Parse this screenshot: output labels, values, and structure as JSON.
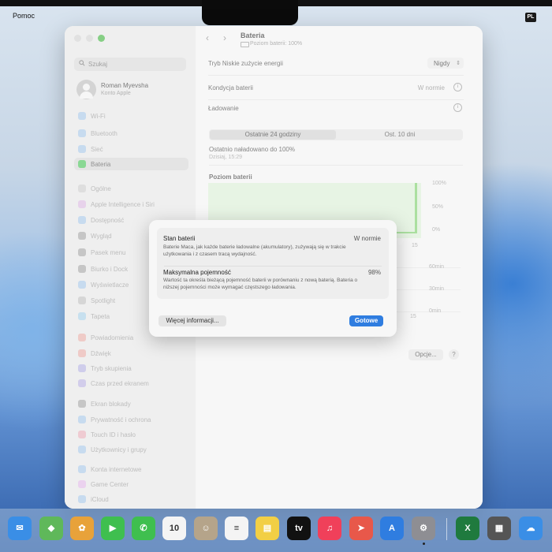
{
  "menubar": {
    "menu": "Pomoc",
    "input_source": "PL"
  },
  "search": {
    "placeholder": "Szukaj"
  },
  "profile": {
    "name": "Roman Myevsha",
    "subtitle": "Konto Apple"
  },
  "sidebar": {
    "items": [
      {
        "label": "Wi-Fi",
        "icon": "wifi-icon",
        "color": "#3a8ee6"
      },
      {
        "label": "Bluetooth",
        "icon": "bluetooth-icon",
        "color": "#3a8ee6"
      },
      {
        "label": "Sieć",
        "icon": "globe-icon",
        "color": "#3a8ee6"
      },
      {
        "label": "Bateria",
        "icon": "battery-icon",
        "color": "#4cc35b",
        "selected": true
      },
      {
        "label": "Ogólne",
        "icon": "gear-icon",
        "color": "#9a9a9a"
      },
      {
        "label": "Apple Intelligence i Siri",
        "icon": "siri-icon",
        "color": "#c46ad8"
      },
      {
        "label": "Dostępność",
        "icon": "accessibility-icon",
        "color": "#3a8ee6"
      },
      {
        "label": "Wygląd",
        "icon": "appearance-icon",
        "color": "#333333"
      },
      {
        "label": "Pasek menu",
        "icon": "menubar-icon",
        "color": "#333333"
      },
      {
        "label": "Biurko i Dock",
        "icon": "dock-icon",
        "color": "#333333"
      },
      {
        "label": "Wyświetlacze",
        "icon": "display-icon",
        "color": "#3a8ee6"
      },
      {
        "label": "Spotlight",
        "icon": "spotlight-icon",
        "color": "#7a7a7a"
      },
      {
        "label": "Tapeta",
        "icon": "wallpaper-icon",
        "color": "#3aa7e6"
      },
      {
        "label": "Powiadomienia",
        "icon": "bell-icon",
        "color": "#e64b3a"
      },
      {
        "label": "Dźwięk",
        "icon": "speaker-icon",
        "color": "#e6453a"
      },
      {
        "label": "Tryb skupienia",
        "icon": "moon-icon",
        "color": "#5b4fd6"
      },
      {
        "label": "Czas przed ekranem",
        "icon": "hourglass-icon",
        "color": "#6a4fd6"
      },
      {
        "label": "Ekran blokady",
        "icon": "lock-screen-icon",
        "color": "#333333"
      },
      {
        "label": "Prywatność i ochrona",
        "icon": "hand-icon",
        "color": "#3a8ee6"
      },
      {
        "label": "Touch ID i hasło",
        "icon": "fingerprint-icon",
        "color": "#e64b6a"
      },
      {
        "label": "Użytkownicy i grupy",
        "icon": "users-icon",
        "color": "#3a8ee6"
      },
      {
        "label": "Konta internetowe",
        "icon": "at-icon",
        "color": "#3a8ee6"
      },
      {
        "label": "Game Center",
        "icon": "gamecenter-icon",
        "color": "#d86ae6"
      },
      {
        "label": "iCloud",
        "icon": "cloud-icon",
        "color": "#3a8ee6"
      }
    ]
  },
  "main": {
    "title": "Bateria",
    "subtitle": "Poziom baterii: 100%",
    "low_power": {
      "label": "Tryb Niskie zużycie energii",
      "value": "Nigdy"
    },
    "condition": {
      "label": "Kondycja baterii",
      "value": "W normie"
    },
    "charging": {
      "label": "Ładowanie"
    },
    "tabs": [
      "Ostatnie 24 godziny",
      "Ost. 10 dni"
    ],
    "last_charged": "Ostatnio naładowano do 100%",
    "last_charged_time": "Dzisiaj, 15:29",
    "options_button": "Opcje...",
    "help_button": "?"
  },
  "chart_data": [
    {
      "type": "area",
      "title": "Poziom baterii",
      "y_ticks": [
        "100%",
        "50%",
        "0%"
      ],
      "x_ticks": [
        "15"
      ],
      "ylim": [
        0,
        100
      ],
      "note": "level shown near 100% then charged spike at right edge",
      "color": "#7fcf6e"
    },
    {
      "type": "bar",
      "y_ticks": [
        "60min",
        "30min",
        "0min"
      ],
      "x_ticks": [
        "15"
      ]
    }
  ],
  "sheet": {
    "state_title": "Stan baterii",
    "state_value": "W normie",
    "state_desc": "Baterie Maca, jak każde baterie ładowalne (akumulatory), zużywają się w trakcie użytkowania i z czasem tracą wydajność.",
    "capacity_title": "Maksymalna pojemność",
    "capacity_value": "98%",
    "capacity_desc": "Wartość ta określa bieżącą pojemność baterii w porównaniu z nową baterią. Bateria o niższej pojemności może wymagać częstszego ładowania.",
    "more_button": "Więcej informacji...",
    "done_button": "Gotowe",
    "accent": "#2f7de0"
  },
  "dock": {
    "apps": [
      {
        "name": "mail-icon",
        "color": "#3a8ee6",
        "glyph": "✉"
      },
      {
        "name": "maps-icon",
        "color": "#5fb85a",
        "glyph": "◆"
      },
      {
        "name": "photos-icon",
        "color": "#e8a23a",
        "glyph": "✿"
      },
      {
        "name": "facetime-icon",
        "color": "#3fbf4f",
        "glyph": "▶"
      },
      {
        "name": "phone-icon",
        "color": "#3fbf4f",
        "glyph": "✆"
      },
      {
        "name": "calendar-icon",
        "color": "#f4f4f4",
        "glyph": "10"
      },
      {
        "name": "contacts-icon",
        "color": "#b5a48a",
        "glyph": "☺"
      },
      {
        "name": "reminders-icon",
        "color": "#f4f4f4",
        "glyph": "≡"
      },
      {
        "name": "notes-icon",
        "color": "#f2cf45",
        "glyph": "▤"
      },
      {
        "name": "appletv-icon",
        "color": "#111111",
        "glyph": "tv"
      },
      {
        "name": "music-icon",
        "color": "#f0405a",
        "glyph": "♫"
      },
      {
        "name": "launchpad-icon",
        "color": "#e8584a",
        "glyph": "➤"
      },
      {
        "name": "appstore-icon",
        "color": "#2f7de0",
        "glyph": "A"
      },
      {
        "name": "system-settings-icon",
        "color": "#8e8e93",
        "glyph": "⚙"
      },
      {
        "name": "excel-icon",
        "color": "#1f7a3e",
        "glyph": "X"
      },
      {
        "name": "calculator-icon",
        "color": "#555555",
        "glyph": "▦"
      },
      {
        "name": "weather-icon",
        "color": "#3a8ee6",
        "glyph": "☁"
      }
    ]
  }
}
